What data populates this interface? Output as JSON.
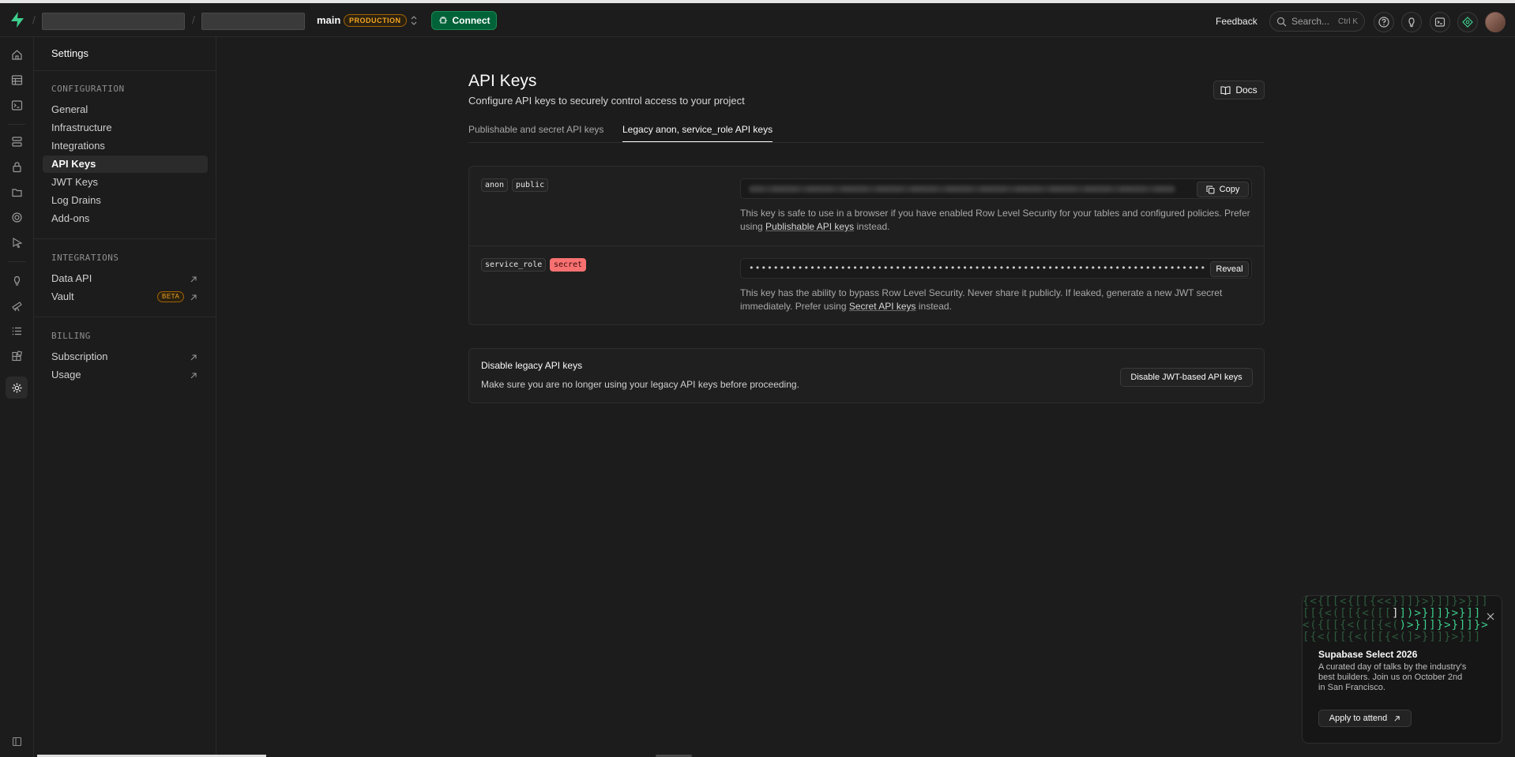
{
  "header": {
    "branch": "main",
    "env_badge": "PRODUCTION",
    "connect_label": "Connect",
    "feedback_label": "Feedback",
    "search_placeholder": "Search...",
    "search_shortcut": "Ctrl K"
  },
  "sidebar": {
    "title": "Settings",
    "sections": [
      {
        "label": "CONFIGURATION",
        "items": [
          "General",
          "Infrastructure",
          "Integrations",
          "API Keys",
          "JWT Keys",
          "Log Drains",
          "Add-ons"
        ]
      },
      {
        "label": "INTEGRATIONS",
        "items": [
          "Data API",
          "Vault"
        ],
        "vault_badge": "BETA"
      },
      {
        "label": "BILLING",
        "items": [
          "Subscription",
          "Usage"
        ]
      }
    ],
    "active_item": "API Keys"
  },
  "page": {
    "title": "API Keys",
    "subtitle": "Configure API keys to securely control access to your project",
    "docs_label": "Docs",
    "tabs": [
      {
        "label": "Publishable and secret API keys",
        "active": false
      },
      {
        "label": "Legacy anon, service_role API keys",
        "active": true
      }
    ]
  },
  "keys": {
    "anon": {
      "name_tag": "anon",
      "scope_tag": "public",
      "copy_label": "Copy",
      "help_prefix": "This key is safe to use in a browser if you have enabled Row Level Security for your tables and configured policies. Prefer using ",
      "help_link": "Publishable API keys",
      "help_suffix": " instead."
    },
    "service_role": {
      "name_tag": "service_role",
      "scope_tag": "secret",
      "masked_value": "••••••••••••••••••••••••••••••••••••••••••••••••••••••••••••••••••••••••••••••",
      "reveal_label": "Reveal",
      "help_prefix": "This key has the ability to bypass Row Level Security. Never share it publicly. If leaked, generate a new JWT secret immediately. Prefer using ",
      "help_link": "Secret API keys",
      "help_suffix": " instead."
    }
  },
  "disable_legacy": {
    "title": "Disable legacy API keys",
    "description": "Make sure you are no longer using your legacy API keys before proceeding.",
    "button_label": "Disable JWT-based API keys"
  },
  "promo": {
    "title": "Supabase Select 2026",
    "body": "A curated day of talks by the industry's best builders. Join us on October 2nd in San Francisco.",
    "button_label": "Apply to attend"
  },
  "colors": {
    "accent_green": "#3ecf8e",
    "connect_bg": "#006239",
    "warning": "#f5a524",
    "danger": "#f87171",
    "background": "#1c1c1c"
  }
}
